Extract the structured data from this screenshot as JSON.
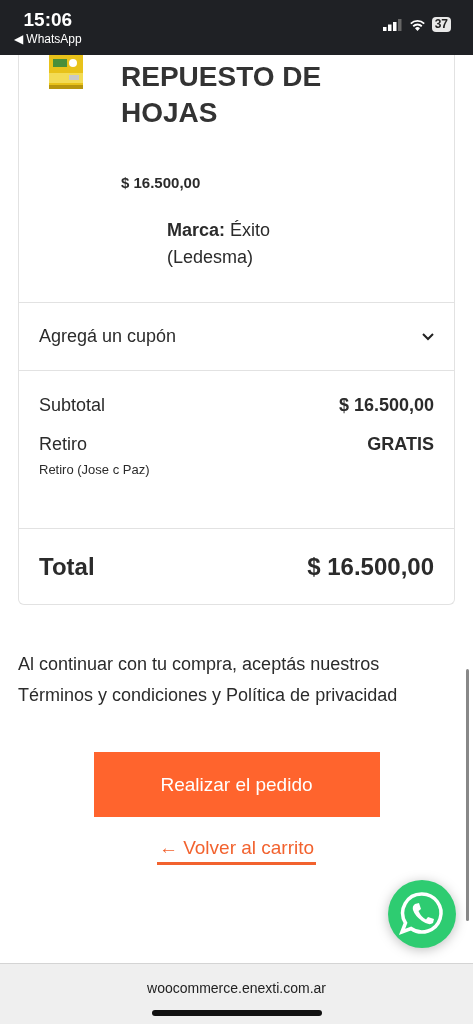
{
  "status_bar": {
    "time": "15:06",
    "back_label": "◀ WhatsApp",
    "battery": "37"
  },
  "product": {
    "title": "REPUESTO DE HOJAS",
    "price": "$ 16.500,00",
    "attribute": "**Marca:** Éxito (Ledesma)"
  },
  "coupon": {
    "label": "Agregá un cupón",
    "expanded": false
  },
  "totals": [
    {
      "label": "Subtotal",
      "value": "$ 16.500,00"
    },
    {
      "label": "Retiro",
      "value": "GRATIS",
      "note": "Retiro (Jose c Paz)"
    }
  ],
  "total": {
    "label": "Total",
    "value": "$ 16.500,00"
  },
  "legal_text": "Al continuar con tu compra, aceptás nuestros Términos y condiciones y Política de privacidad",
  "place_order_button": "Realizar el pedido",
  "back_link": "← Volver al carrito",
  "browser_bar": {
    "url": "woocommerce.enexti.com.ar"
  }
}
